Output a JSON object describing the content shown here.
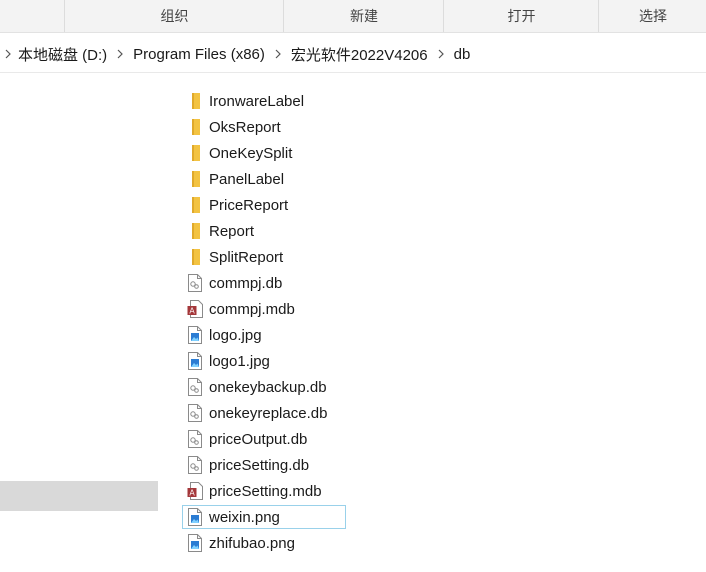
{
  "ribbon": {
    "groups": [
      "组织",
      "新建",
      "打开",
      "选择"
    ]
  },
  "breadcrumb": {
    "items": [
      "本地磁盘 (D:)",
      "Program Files (x86)",
      "宏光软件2022V4206",
      "db"
    ]
  },
  "files": [
    {
      "name": "IronwareLabel",
      "icon": "folder-icon"
    },
    {
      "name": "OksReport",
      "icon": "folder-icon"
    },
    {
      "name": "OneKeySplit",
      "icon": "folder-icon"
    },
    {
      "name": "PanelLabel",
      "icon": "folder-icon"
    },
    {
      "name": "PriceReport",
      "icon": "folder-icon"
    },
    {
      "name": "Report",
      "icon": "folder-icon"
    },
    {
      "name": "SplitReport",
      "icon": "folder-icon"
    },
    {
      "name": "commpj.db",
      "icon": "db-file-icon"
    },
    {
      "name": "commpj.mdb",
      "icon": "access-db-icon"
    },
    {
      "name": "logo.jpg",
      "icon": "image-file-icon"
    },
    {
      "name": "logo1.jpg",
      "icon": "image-file-icon"
    },
    {
      "name": "onekeybackup.db",
      "icon": "db-file-icon"
    },
    {
      "name": "onekeyreplace.db",
      "icon": "db-file-icon"
    },
    {
      "name": "priceOutput.db",
      "icon": "db-file-icon"
    },
    {
      "name": "priceSetting.db",
      "icon": "db-file-icon"
    },
    {
      "name": "priceSetting.mdb",
      "icon": "access-db-icon"
    },
    {
      "name": "weixin.png",
      "icon": "image-file-icon"
    },
    {
      "name": "zhifubao.png",
      "icon": "image-file-icon"
    }
  ],
  "focused_file": "weixin.png",
  "colors": {
    "folder": "#f3c342",
    "access": "#a4373a",
    "image": "#2b7cd3",
    "focus_border": "#99d1ea"
  }
}
